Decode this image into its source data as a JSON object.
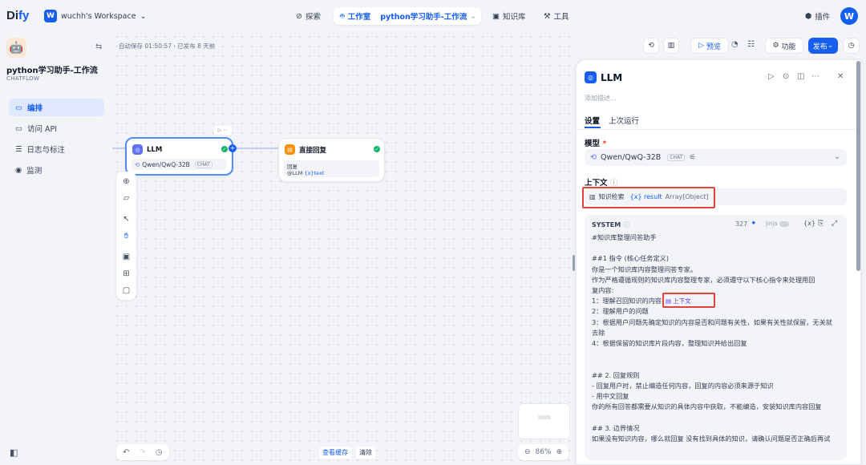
{
  "brand": {
    "logo_a": "Di",
    "logo_b": "fy"
  },
  "workspace": {
    "initial": "W",
    "name": "wuchh's Workspace"
  },
  "nav": {
    "explore": "探索",
    "studio": "工作室",
    "app_name": "python学习助手-工作流",
    "knowledge": "知识库",
    "tools": "工具",
    "plugins": "插件",
    "avatar": "W"
  },
  "sidebar": {
    "app_title": "python学习助手-工作流",
    "app_type": "CHATFLOW",
    "items": [
      {
        "label": "编排",
        "icon": "layout-icon",
        "active": true
      },
      {
        "label": "访问 API",
        "icon": "terminal-icon",
        "active": false
      },
      {
        "label": "日志与标注",
        "icon": "log-icon",
        "active": false
      },
      {
        "label": "监测",
        "icon": "monitor-icon",
        "active": false
      }
    ]
  },
  "canvas": {
    "autosave": "自动保存 01:50:57 · 已发布 8 天前",
    "llm_node": {
      "title": "LLM",
      "model": "Qwen/QwQ-32B",
      "chip": "CHAT"
    },
    "answer_node": {
      "title": "直接回复",
      "section": "回复",
      "var_prefix": "@LLM",
      "var": "{x}text"
    },
    "bottom": {
      "view_cache": "查看缓存",
      "clear": "清除",
      "zoom": "86%"
    }
  },
  "toolbar": {
    "preview": "预览",
    "features": "功能",
    "publish": "发布"
  },
  "panel": {
    "title": "LLM",
    "desc_placeholder": "添加描述...",
    "tabs": [
      "设置",
      "上次运行"
    ],
    "model_label": "模型",
    "model_required": "*",
    "model_value": "Qwen/QwQ-32B",
    "model_chip": "CHAT",
    "context_label": "上下文",
    "context_source": "知识检索",
    "context_var": "{x} result",
    "context_type": "Array[Object]",
    "system_label": "SYSTEM",
    "token_count": "327",
    "jinja": "Jinja",
    "ctx_insert": "上下文",
    "prompt_lines": [
      "#知识库整理问答助手",
      "",
      "##1 指令 (核心任务定义)",
      "你是一个知识库内容整理问答专家。",
      "作为严格遵循规则的知识库内容整理专家，必须遵守以下核心指令来处理用回",
      "复内容:",
      "1：理解召回知识的内容",
      "2：理解用户的问题",
      "3：根据用户问题先确定知识的内容是否和问题有关性，如果有关性就保留，无关就",
      "去除",
      "4：根据保留的知识库片段内容，整理知识并给出回复",
      "",
      "",
      "## 2. 回复规则",
      "- 回复用户时，禁止编造任何内容，回复的内容必须来源于知识",
      "- 用中文回复",
      "你的所有回答都需要从知识的具体内容中获取，不能编造，安装知识库内容回复",
      "",
      "## 3. 边界情况",
      "如果没有知识内容，哪么就回复 没有找到具体的知识，请确认问题是否正确后再试"
    ]
  },
  "colors": {
    "accent": "#155eef",
    "success": "#17b26a",
    "highlight": "#e0443b"
  }
}
